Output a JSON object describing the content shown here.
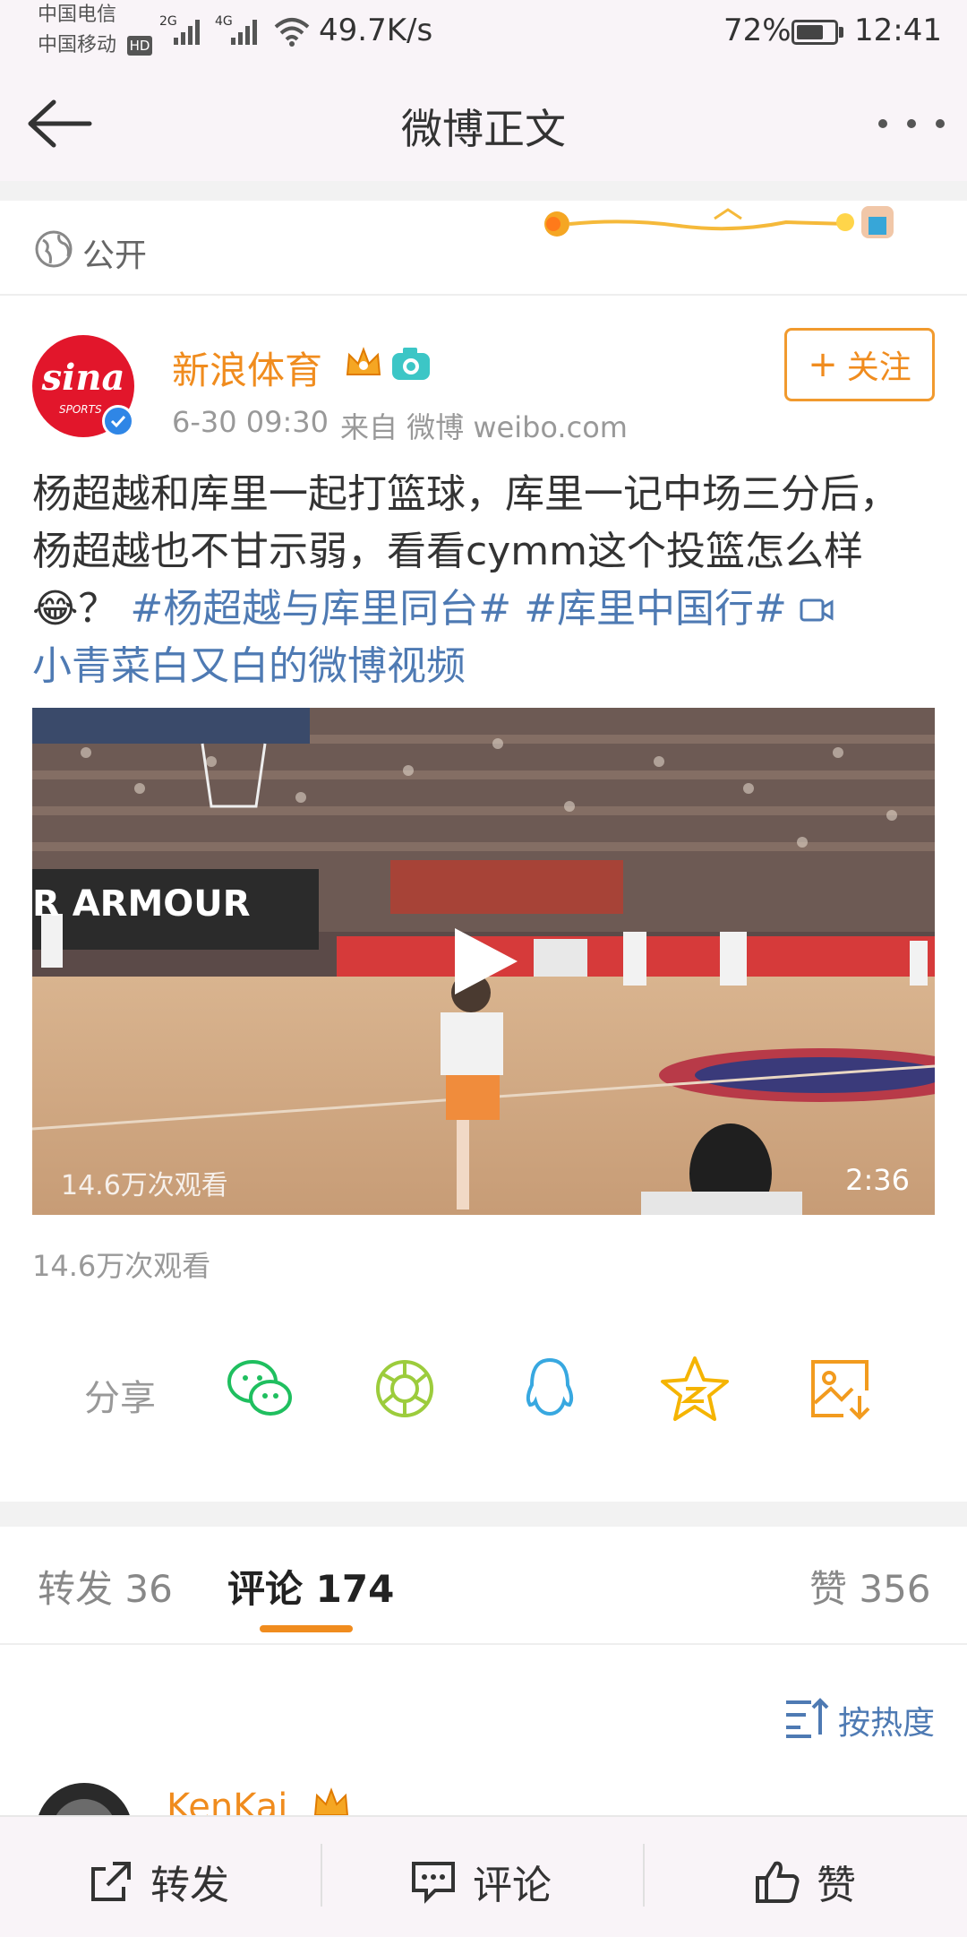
{
  "status_bar": {
    "carrier_1": "中国电信",
    "carrier_2": "中国移动",
    "hd": "HD",
    "net_2g": "2G",
    "net_4g": "4G",
    "speed": "49.7K/s",
    "battery": "72%",
    "battery_level": 0.72,
    "time": "12:41"
  },
  "nav": {
    "title": "微博正文"
  },
  "visibility": {
    "label": "公开"
  },
  "post": {
    "author": "新浪体育",
    "avatar_text": "sina",
    "avatar_sub": "SPORTS",
    "time": "6-30 09:30",
    "source": "来自 微博 weibo.com",
    "follow_label": "关注",
    "text_main": "杨超越和库里一起打篮球，库里一记中场三分后，杨超越也不甘示弱，看看cymm这个投篮怎么样",
    "emoji": "😂",
    "text_q": "？",
    "topic_1": "#杨超越与库里同台#",
    "topic_2": "#库里中国行#",
    "video_link": "小青菜白又白的微博视频"
  },
  "video": {
    "overlay_views": "14.6万次观看",
    "duration": "2:36",
    "banner_text": "R ARMOUR"
  },
  "views_text": "14.6万次观看",
  "share": {
    "label": "分享",
    "icons": [
      "wechat-icon",
      "moments-icon",
      "qq-icon",
      "qzone-icon",
      "save-image-icon"
    ]
  },
  "tabs": {
    "repost": "转发 36",
    "comment": "评论 174",
    "like": "赞 356"
  },
  "sort": {
    "label": "按热度"
  },
  "comment_preview": {
    "user": "KenKai"
  },
  "bottom_bar": {
    "repost": "转发",
    "comment": "评论",
    "like": "赞"
  },
  "colors": {
    "accent": "#f08c1e",
    "link": "#4e7ab3",
    "bar_bg": "#f9f4f8",
    "sina_red": "#e2162b"
  }
}
